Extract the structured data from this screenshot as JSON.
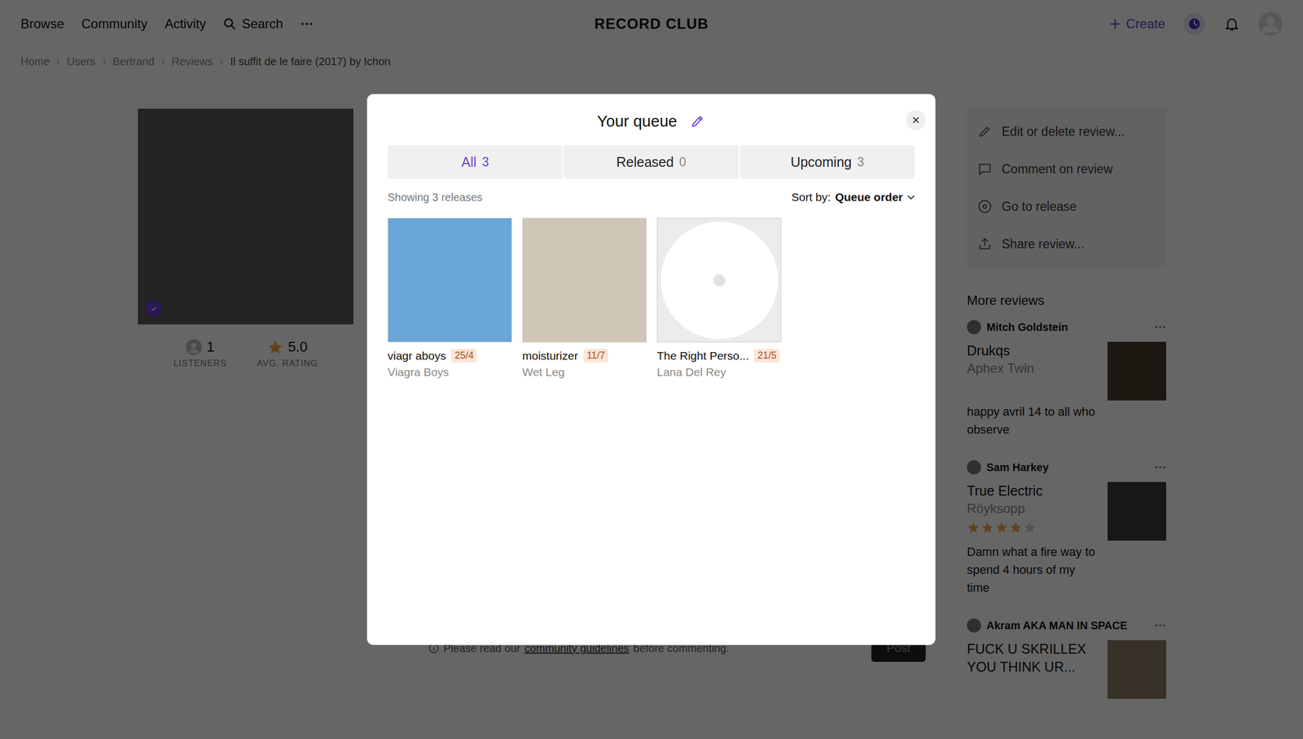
{
  "nav": {
    "items": [
      "Browse",
      "Community",
      "Activity"
    ],
    "search": "Search",
    "logo": "RECORD CLUB",
    "create": "Create"
  },
  "breadcrumb": [
    "Home",
    "Users",
    "Bertrand",
    "Reviews",
    "Il suffit de le faire (2017) by Ichon"
  ],
  "release": {
    "verified": true,
    "listeners": "1",
    "listeners_label": "LISTENERS",
    "rating": "5.0",
    "rating_label": "AVG. RATING"
  },
  "actions": [
    {
      "label": "Edit or delete review...",
      "kind": "edit"
    },
    {
      "label": "Comment on review",
      "kind": "comment"
    },
    {
      "label": "Go to release",
      "kind": "release"
    },
    {
      "label": "Share review...",
      "kind": "share"
    }
  ],
  "more_reviews": {
    "title": "More reviews",
    "items": [
      {
        "user": "Mitch Goldstein",
        "title": "Drukqs",
        "artist": "Aphex Twin",
        "stars": 0,
        "text": "happy avril 14 to all who observe",
        "color": "#4a3b2e"
      },
      {
        "user": "Sam Harkey",
        "title": "True Electric",
        "artist": "Röyksopp",
        "stars": 4,
        "text": "Damn what a fire way to spend 4 hours of my time",
        "color": "#3a3a3a"
      },
      {
        "user": "Akram AKA MAN IN SPACE",
        "title": "FUCK U SKRILLEX YOU THINK UR...",
        "artist": "",
        "stars": 0,
        "text": "",
        "color": "#8a7a68"
      }
    ]
  },
  "comment": {
    "notice_pre": "Please read our",
    "link": "community guidelines",
    "notice_post": "before commenting.",
    "post": "Post"
  },
  "queue": {
    "title": "Your queue",
    "tabs": [
      {
        "label": "All",
        "count": "3",
        "selected": true
      },
      {
        "label": "Released",
        "count": "0",
        "selected": false
      },
      {
        "label": "Upcoming",
        "count": "3",
        "selected": false
      }
    ],
    "showing": "Showing 3 releases",
    "sort_label": "Sort by:",
    "sort_value": "Queue order",
    "releases": [
      {
        "title": "viagr aboys",
        "date": "25/4",
        "artist": "Viagra Boys",
        "kind": "photo",
        "color": "#6aa6d8"
      },
      {
        "title": "moisturizer",
        "date": "11/7",
        "artist": "Wet Leg",
        "kind": "photo",
        "color": "#cfc6b8"
      },
      {
        "title": "The Right Perso...",
        "date": "21/5",
        "artist": "Lana Del Rey",
        "kind": "placeholder",
        "color": "#ececec"
      }
    ]
  }
}
